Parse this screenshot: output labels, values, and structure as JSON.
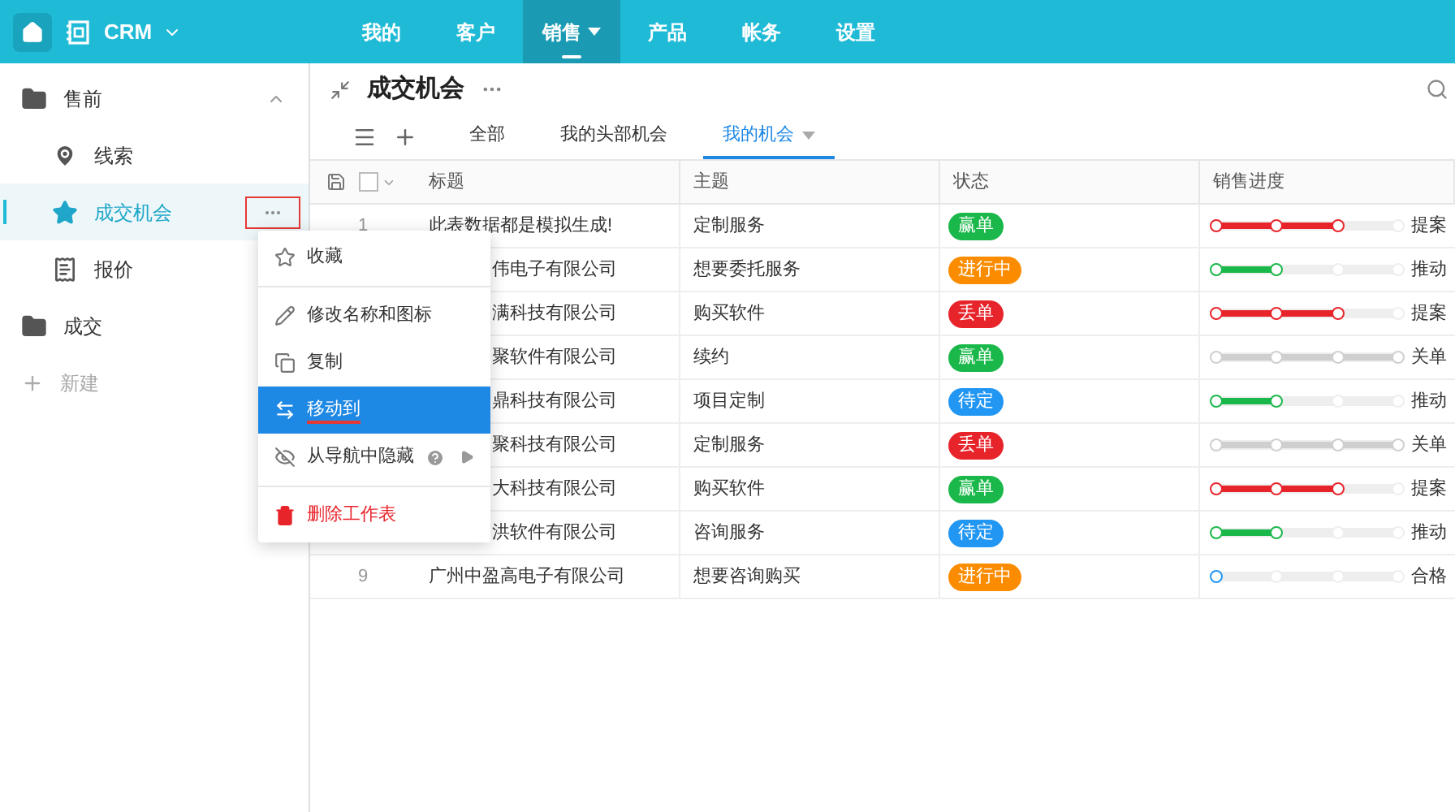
{
  "app": {
    "name": "CRM"
  },
  "nav": [
    {
      "label": "我的",
      "selected": false
    },
    {
      "label": "客户",
      "selected": false
    },
    {
      "label": "销售",
      "selected": true
    },
    {
      "label": "产品",
      "selected": false
    },
    {
      "label": "帐务",
      "selected": false
    },
    {
      "label": "设置",
      "selected": false
    }
  ],
  "sidebar": {
    "groups": [
      {
        "label": "售前",
        "expanded": true,
        "children": [
          {
            "label": "线索",
            "kind": "pin",
            "selected": false
          },
          {
            "label": "成交机会",
            "kind": "star",
            "selected": true
          },
          {
            "label": "报价",
            "kind": "quote",
            "selected": false
          }
        ]
      },
      {
        "label": "成交",
        "expanded": false
      }
    ],
    "new_label": "新建"
  },
  "context_menu": {
    "items": [
      {
        "label": "收藏",
        "kind": "star",
        "selected": false
      },
      {
        "kind": "divider"
      },
      {
        "label": "修改名称和图标",
        "kind": "edit",
        "selected": false
      },
      {
        "label": "复制",
        "kind": "copy",
        "selected": false
      },
      {
        "label": "移动到",
        "kind": "move",
        "selected": true
      },
      {
        "label": "从导航中隐藏",
        "kind": "hide",
        "selected": false
      },
      {
        "kind": "divider"
      },
      {
        "label": "删除工作表",
        "kind": "delete",
        "selected": false
      }
    ]
  },
  "view": {
    "title": "成交机会",
    "tabs": [
      {
        "label": "全部",
        "selected": false
      },
      {
        "label": "我的头部机会",
        "selected": false
      },
      {
        "label": "我的机会",
        "selected": true
      }
    ]
  },
  "table": {
    "select_all": {
      "checked": false
    },
    "columns": [
      "标题",
      "主题",
      "状态",
      "销售进度"
    ],
    "rows": [
      {
        "num": "1",
        "title": "此表数据都是模拟生成!",
        "partial": false,
        "topic": "定制服务",
        "status": {
          "label": "赢单",
          "color": "#1ab84a"
        },
        "progress": {
          "level": 0.67,
          "color": "#e8242b"
        },
        "stage": "提案"
      },
      {
        "title": "伟电子有限公司",
        "partial": true,
        "topic": "想要委托服务",
        "status": {
          "label": "进行中",
          "color": "#fb8c00"
        },
        "progress": {
          "level": 0.33,
          "color": "#1ab84a"
        },
        "stage": "推动"
      },
      {
        "title": "满科技有限公司",
        "partial": true,
        "topic": "购买软件",
        "status": {
          "label": "丢单",
          "color": "#e8242b"
        },
        "progress": {
          "level": 0.67,
          "color": "#e8242b"
        },
        "stage": "提案"
      },
      {
        "title": "聚软件有限公司",
        "partial": true,
        "topic": "续约",
        "status": {
          "label": "赢单",
          "color": "#1ab84a"
        },
        "progress": {
          "level": 1,
          "color": "#cfcfcf"
        },
        "stage": "关单"
      },
      {
        "title": "鼎科技有限公司",
        "partial": true,
        "topic": "项目定制",
        "status": {
          "label": "待定",
          "color": "#2196f3"
        },
        "progress": {
          "level": 0.33,
          "color": "#1ab84a"
        },
        "stage": "推动"
      },
      {
        "title": "聚科技有限公司",
        "partial": true,
        "topic": "定制服务",
        "status": {
          "label": "丢单",
          "color": "#e8242b"
        },
        "progress": {
          "level": 1,
          "color": "#cfcfcf"
        },
        "stage": "关单"
      },
      {
        "title": "大科技有限公司",
        "partial": true,
        "topic": "购买软件",
        "status": {
          "label": "赢单",
          "color": "#1ab84a"
        },
        "progress": {
          "level": 0.67,
          "color": "#e8242b"
        },
        "stage": "提案"
      },
      {
        "title": "洪软件有限公司",
        "partial": true,
        "topic": "咨询服务",
        "status": {
          "label": "待定",
          "color": "#2196f3"
        },
        "progress": {
          "level": 0.33,
          "color": "#1ab84a"
        },
        "stage": "推动"
      },
      {
        "num": "9",
        "title": "广州中盈高电子有限公司",
        "partial": false,
        "topic": "想要咨询购买",
        "status": {
          "label": "进行中",
          "color": "#fb8c00"
        },
        "progress": {
          "level": 0,
          "color": "#2196f3"
        },
        "stage": "合格"
      }
    ]
  }
}
